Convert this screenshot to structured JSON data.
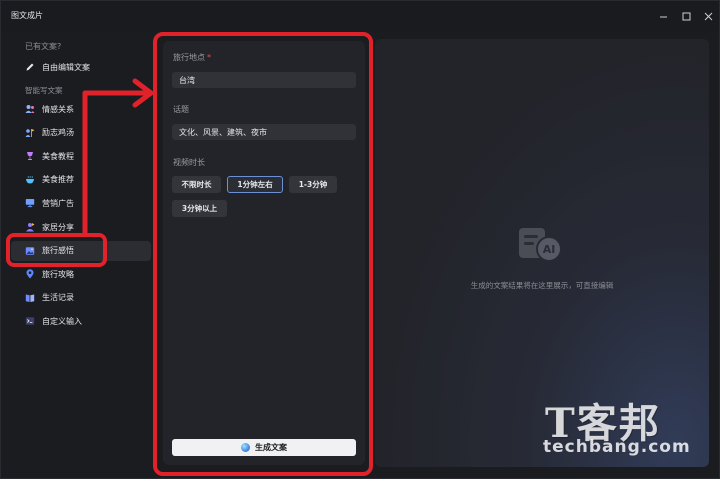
{
  "window": {
    "title": "图文成片"
  },
  "sidebar": {
    "section_have_copy": "已有文案?",
    "free_edit": "自由编辑文案",
    "section_smart": "智能写文案",
    "items": [
      {
        "label": "情感关系",
        "icon": "people-icon",
        "color": "#8fb2ff"
      },
      {
        "label": "励志鸡汤",
        "icon": "person-flag-icon",
        "color": "#7fa8ff"
      },
      {
        "label": "美食教程",
        "icon": "goblet-icon",
        "color": "#c37cff"
      },
      {
        "label": "美食推荐",
        "icon": "bowl-icon",
        "color": "#4ec3ff"
      },
      {
        "label": "营销广告",
        "icon": "monitor-icon",
        "color": "#6fa0ff"
      },
      {
        "label": "家居分享",
        "icon": "home-person-icon",
        "color": "#8c7cff"
      },
      {
        "label": "旅行感悟",
        "icon": "photo-icon",
        "color": "#6d8dff",
        "active": true
      },
      {
        "label": "旅行攻略",
        "icon": "map-pin-icon",
        "color": "#5c86ff"
      },
      {
        "label": "生活记录",
        "icon": "book-icon",
        "color": "#6f8cff"
      },
      {
        "label": "自定义输入",
        "icon": "terminal-icon",
        "color": "#7d8cff"
      }
    ]
  },
  "form": {
    "location_label": "旅行地点",
    "location_required": "*",
    "location_value": "台湾",
    "topic_label": "话题",
    "topic_value": "文化、风景、建筑、夜市",
    "duration_label": "视频时长",
    "durations": [
      {
        "label": "不限时长",
        "selected": false
      },
      {
        "label": "1分钟左右",
        "selected": true
      },
      {
        "label": "1-3分钟",
        "selected": false
      },
      {
        "label": "3分钟以上",
        "selected": false
      }
    ],
    "generate_label": "生成文案"
  },
  "preview": {
    "hint": "生成的文案结果将在这里展示，可直接编辑",
    "icon_text": "AI"
  },
  "watermark": {
    "chinese": "T客邦",
    "domain": "techbang.com"
  },
  "colors": {
    "accent_red": "#e1222a",
    "selected_border": "#6d8fd6"
  }
}
